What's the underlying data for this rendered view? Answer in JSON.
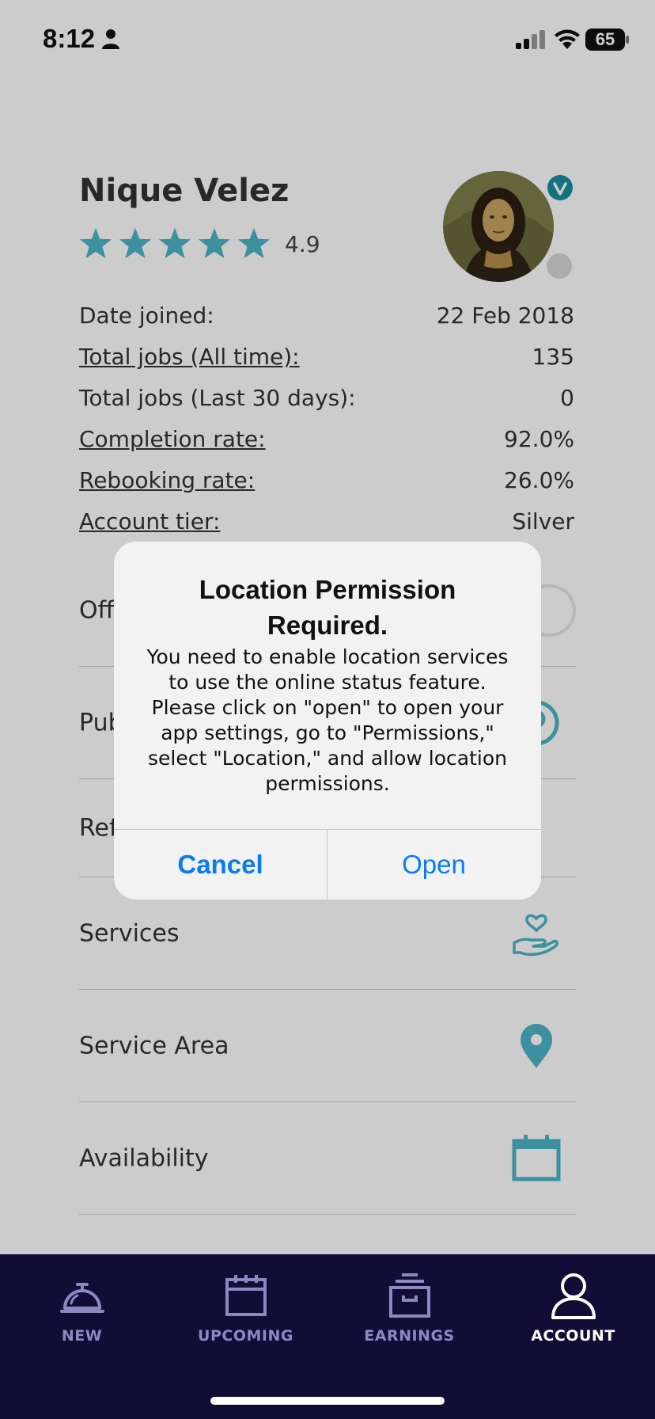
{
  "status_bar": {
    "time": "8:12",
    "battery": "65"
  },
  "profile": {
    "name": "Nique Velez",
    "rating": "4.9",
    "stars": 5,
    "star_color": "#4db4c6",
    "stats": [
      {
        "label": "Date joined:",
        "value": "22 Feb 2018",
        "link": false
      },
      {
        "label": "Total jobs (All time):",
        "value": "135",
        "link": true
      },
      {
        "label": "Total jobs (Last 30 days):",
        "value": "0",
        "link": false
      },
      {
        "label": "Completion rate:",
        "value": "92.0%",
        "link": true
      },
      {
        "label": "Rebooking rate:",
        "value": "26.0%",
        "link": true
      },
      {
        "label": "Account tier:",
        "value": "Silver",
        "link": true
      }
    ]
  },
  "menu": {
    "items": [
      {
        "label": "Off",
        "icon": "toggle-switch"
      },
      {
        "label": "Pub",
        "icon": "profile-icon"
      },
      {
        "label": "Ref",
        "icon": "none"
      },
      {
        "label": "Services",
        "icon": "hand-heart-icon"
      },
      {
        "label": "Service Area",
        "icon": "map-pin-icon"
      },
      {
        "label": "Availability",
        "icon": "calendar-icon"
      }
    ]
  },
  "alert": {
    "title": "Location Permission Required.",
    "message": "You need to enable location services to use the online status feature. Please click on \"open\" to open your app settings, go to \"Permissions,\" select \"Location,\" and allow location permissions.",
    "cancel_label": "Cancel",
    "open_label": "Open",
    "button_color": "#0a7af5"
  },
  "tabbar": {
    "tabs": [
      {
        "label": "NEW",
        "icon": "service-bell-icon",
        "active": false
      },
      {
        "label": "UPCOMING",
        "icon": "calendar-icon",
        "active": false
      },
      {
        "label": "EARNINGS",
        "icon": "archive-box-icon",
        "active": false
      },
      {
        "label": "ACCOUNT",
        "icon": "user-icon",
        "active": true
      }
    ],
    "background": "#110d36"
  }
}
